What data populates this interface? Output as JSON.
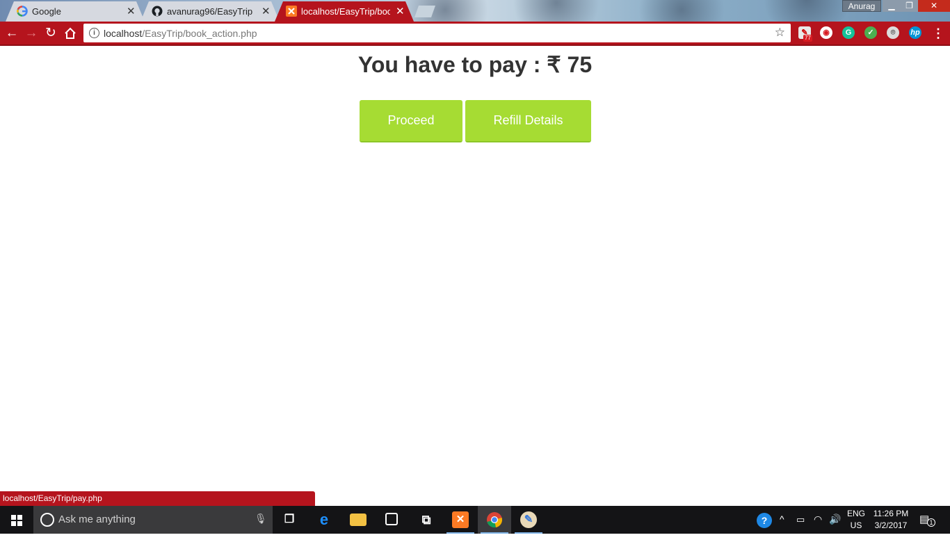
{
  "browser": {
    "tabs": [
      {
        "title": "Google",
        "icon": "google-favicon",
        "active": false
      },
      {
        "title": "avanurag96/EasyTrip",
        "icon": "github-favicon",
        "active": false
      },
      {
        "title": "localhost/EasyTrip/book_",
        "icon": "xampp-favicon",
        "active": true
      }
    ],
    "profile_name": "Anurag",
    "address": {
      "host": "localhost",
      "path": "/EasyTrip/book_action.php"
    },
    "extension_badge": "77",
    "status_url": "localhost/EasyTrip/pay.php",
    "accent_color": "#b5141d"
  },
  "page": {
    "heading": "You have to pay : ₹ 75",
    "buttons": {
      "proceed": "Proceed",
      "refill": "Refill Details"
    },
    "button_color": "#a6dc33"
  },
  "taskbar": {
    "search_placeholder": "Ask me anything",
    "language": {
      "line1": "ENG",
      "line2": "US"
    },
    "time": "11:26 PM",
    "date": "3/2/2017",
    "notification_count": "1"
  }
}
